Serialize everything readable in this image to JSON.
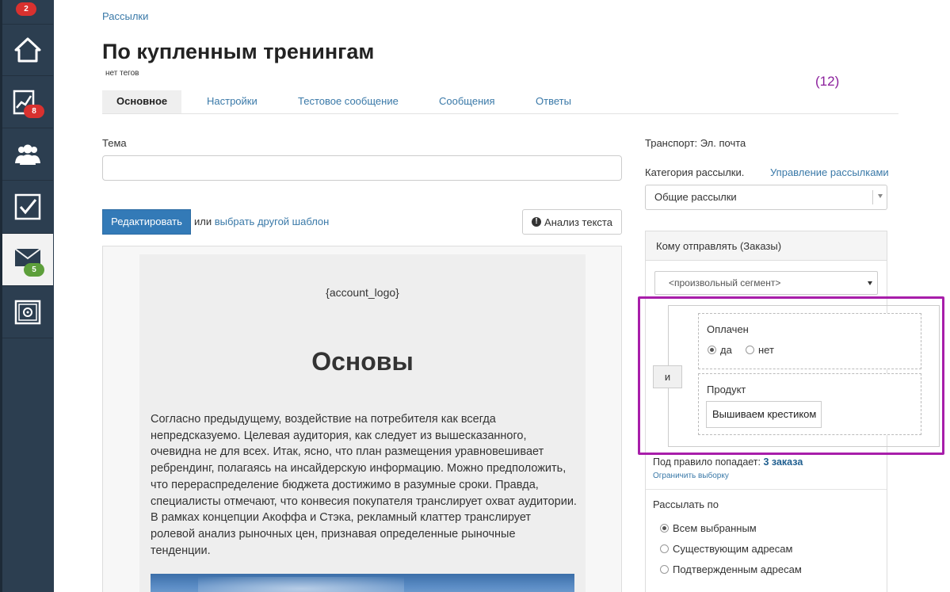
{
  "sidebar": {
    "items": [
      {
        "name": "home",
        "badge": "2",
        "badge_color": "#d9312f"
      },
      {
        "name": "analytics",
        "badge": "8",
        "badge_color": "#d9312f"
      },
      {
        "name": "users",
        "badge": null
      },
      {
        "name": "tasks",
        "badge": null
      },
      {
        "name": "mail",
        "badge": "5",
        "badge_color": "#5d9f3b"
      },
      {
        "name": "safe",
        "badge": null
      }
    ]
  },
  "header": {
    "breadcrumb": "Рассылки",
    "title": "По купленным тренингам",
    "tags": "нет тегов",
    "count_note": "(12)"
  },
  "tabs": [
    {
      "label": "Основное",
      "active": true
    },
    {
      "label": "Настройки"
    },
    {
      "label": "Тестовое сообщение"
    },
    {
      "label": "Сообщения"
    },
    {
      "label": "Ответы"
    }
  ],
  "editor": {
    "subject_label": "Тема",
    "subject_value": "",
    "edit_button": "Редактировать",
    "or_text": "или",
    "choose_template": "выбрать другой шаблон",
    "analyze_button": "Анализ текста"
  },
  "email_preview": {
    "logo_placeholder": "{account_logo}",
    "heading": "Основы",
    "body": "Согласно предыдущему, воздействие на потребителя как всегда непредсказуемо. Целевая аудитория, как следует из вышесказанного, очевидна не для всех. Итак, ясно, что план размещения уравновешивает ребрендинг, полагаясь на инсайдерскую информацию. Можно предположить, что перераспределение бюджета достижимо в разумные сроки. Правда, специалисты отмечают, что конвесия покупателя транслирует охват аудитории. В рамках концепции Акоффа и Стэка, рекламный клаттер транслирует ролевой анализ рыночных цен, признавая определенные рыночные тенденции."
  },
  "settings": {
    "transport": "Транспорт: Эл. почта",
    "category_label": "Категория рассылки.",
    "manage_link": "Управление рассылками",
    "category_value": "Общие рассылки",
    "recipients_header": "Кому отправлять (Заказы)",
    "segment_value": "<произвольный сегмент>",
    "and_button": "и",
    "condition_paid": {
      "title": "Оплачен",
      "options": [
        {
          "label": "да",
          "selected": true
        },
        {
          "label": "нет",
          "selected": false
        }
      ]
    },
    "condition_product": {
      "title": "Продукт",
      "value": "Вышиваем крестиком"
    },
    "rule_hits_prefix": "Под правило попадает:",
    "rule_hits_value": "3 заказа",
    "limit_link": "Ограничить выборку",
    "send_to_title": "Рассылать по",
    "send_to_options": [
      {
        "label": "Всем выбранным",
        "selected": true
      },
      {
        "label": "Существующим адресам",
        "selected": false
      },
      {
        "label": "Подтвержденным адресам",
        "selected": false
      }
    ]
  },
  "colors": {
    "sidebar_bg": "#2c3e50",
    "link": "#3a79a8",
    "primary_button": "#337ab7",
    "highlight": "#a81eaa"
  }
}
